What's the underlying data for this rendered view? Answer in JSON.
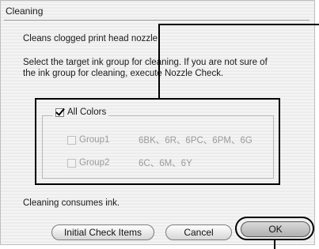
{
  "dialog": {
    "title": "Cleaning",
    "description": "Cleans clogged print head nozzle.",
    "instruction_line1": "Select the target ink group for cleaning. If you are not sure of",
    "instruction_line2": "the ink group for cleaning, execute Nozzle Check."
  },
  "ink_groups": {
    "all_colors": {
      "label": "All Colors",
      "checked": true
    },
    "group1": {
      "label": "Group1",
      "inks": "6BK、6R、6PC、6PM、6G",
      "checked": false,
      "enabled": false
    },
    "group2": {
      "label": "Group2",
      "inks": "6C、6M、6Y",
      "checked": false,
      "enabled": false
    }
  },
  "note": "Cleaning consumes ink.",
  "buttons": {
    "initial_check_items": "Initial Check Items",
    "cancel": "Cancel",
    "ok": "OK"
  }
}
